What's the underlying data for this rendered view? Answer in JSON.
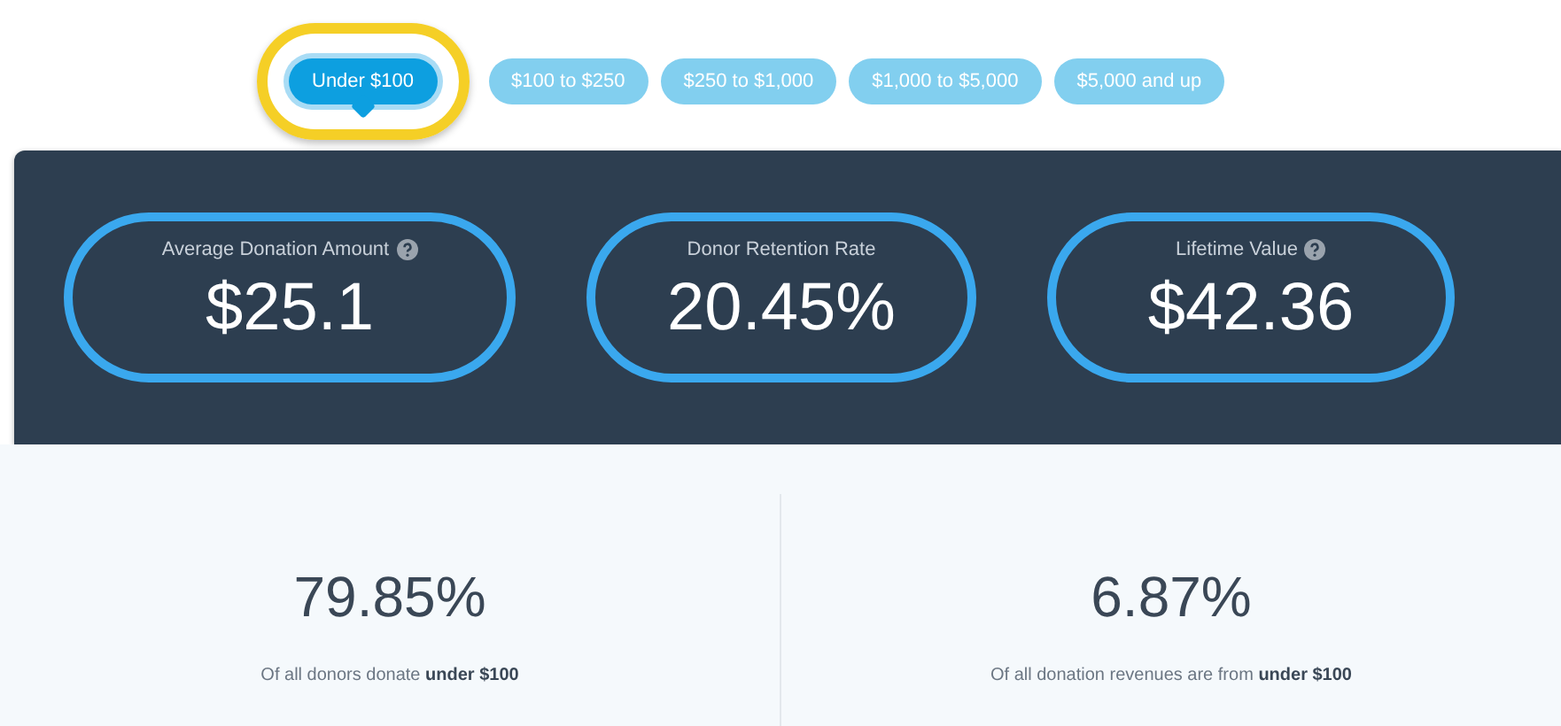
{
  "tabs": [
    {
      "label": "Under $100",
      "selected": true
    },
    {
      "label": "$100 to $250",
      "selected": false
    },
    {
      "label": "$250 to $1,000",
      "selected": false
    },
    {
      "label": "$1,000 to $5,000",
      "selected": false
    },
    {
      "label": "$5,000 and up",
      "selected": false
    }
  ],
  "metrics": [
    {
      "label": "Average Donation Amount",
      "value": "$25.1",
      "help": true
    },
    {
      "label": "Donor Retention Rate",
      "value": "20.45%",
      "help": false
    },
    {
      "label": "Lifetime Value",
      "value": "$42.36",
      "help": true
    }
  ],
  "stats": [
    {
      "value": "79.85%",
      "caption": "Of all donors donate **under $100**"
    },
    {
      "value": "6.87%",
      "caption": "Of all donation revenues are from **under $100**"
    }
  ]
}
